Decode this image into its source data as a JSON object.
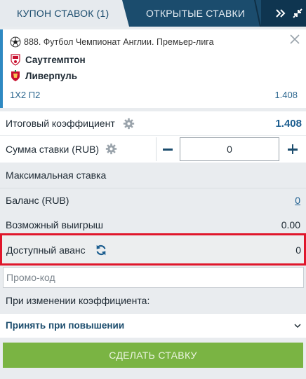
{
  "tabs": {
    "coupon_label": "КУПОН СТАВОК (1)",
    "open_bets_label": "ОТКРЫТЫЕ СТАВКИ"
  },
  "bet": {
    "league": "888. Футбол Чемпионат Англии. Премьер-лига",
    "team_home": "Саутгемптон",
    "team_away": "Ливерпуль",
    "market": "1X2 П2",
    "odds": "1.408"
  },
  "summary": {
    "total_odds_label": "Итоговый коэффициент",
    "total_odds_value": "1.408",
    "stake_label": "Сумма ставки (RUB)",
    "stake_value": "0",
    "max_stake_label": "Максимальная ставка",
    "balance_label": "Баланс (RUB)",
    "balance_value": "0",
    "possible_win_label": "Возможный выигрыш",
    "possible_win_value": "0.00",
    "advance_label": "Доступный аванс",
    "advance_value": "0",
    "promo_placeholder": "Промо-код"
  },
  "odds_change": {
    "label": "При изменении коэффициента:",
    "selected": "Принять при повышении"
  },
  "actions": {
    "make_bet_label": "СДЕЛАТЬ СТАВКУ"
  },
  "colors": {
    "header": "#1b4c6d",
    "accent": "#1b5d8f",
    "highlight": "#e0162b",
    "button": "#7ab443"
  },
  "icons": [
    "expand-icon",
    "collapse-icon",
    "close-icon",
    "football-icon",
    "southampton-crest-icon",
    "liverpool-crest-icon",
    "gear-icon",
    "refresh-icon",
    "chevron-down-icon"
  ]
}
